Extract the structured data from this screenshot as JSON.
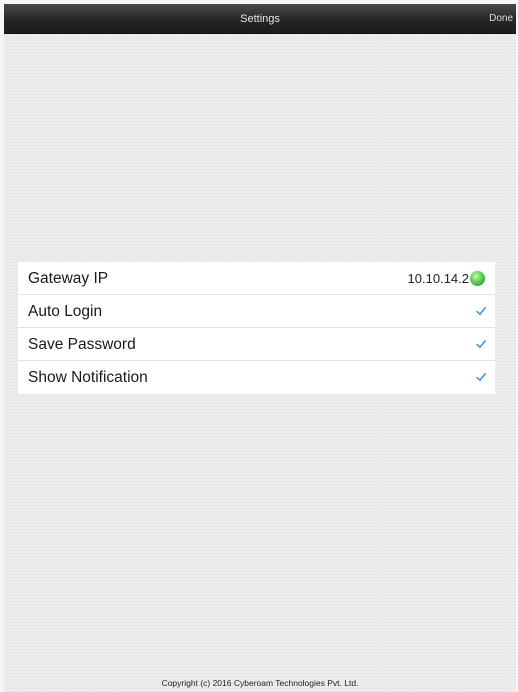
{
  "navbar": {
    "title": "Settings",
    "done_label": "Done"
  },
  "settings": {
    "items": [
      {
        "label": "Gateway IP",
        "value": "10.10.14.2",
        "status_icon": "green-status-dot-icon",
        "status_color": "#3cbf45"
      },
      {
        "label": "Auto Login",
        "checked": true,
        "icon": "checkmark-icon"
      },
      {
        "label": "Save Password",
        "checked": true,
        "icon": "checkmark-icon"
      },
      {
        "label": "Show Notification",
        "checked": true,
        "icon": "checkmark-icon"
      }
    ]
  },
  "footer": {
    "copyright": "Copyright (c) 2016 Cyberoam Technologies Pvt. Ltd."
  },
  "colors": {
    "navbar": "#262626",
    "checkmark": "#2f8fe8",
    "background": "#eeeeee"
  }
}
